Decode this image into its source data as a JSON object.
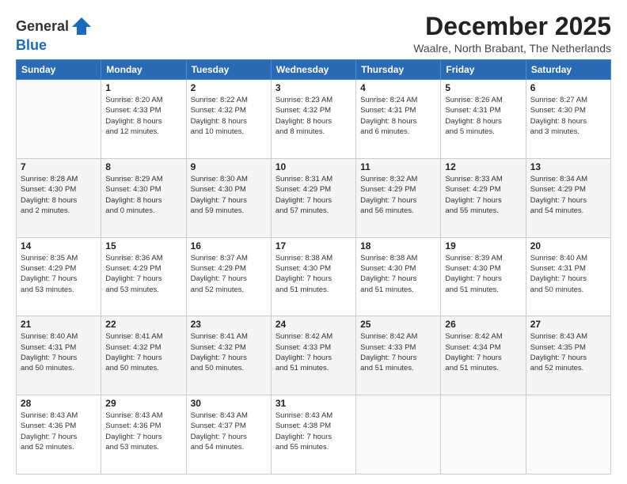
{
  "logo": {
    "line1": "General",
    "line2": "Blue"
  },
  "header": {
    "month_title": "December 2025",
    "subtitle": "Waalre, North Brabant, The Netherlands"
  },
  "days_of_week": [
    "Sunday",
    "Monday",
    "Tuesday",
    "Wednesday",
    "Thursday",
    "Friday",
    "Saturday"
  ],
  "weeks": [
    [
      {
        "day": "",
        "detail": ""
      },
      {
        "day": "1",
        "detail": "Sunrise: 8:20 AM\nSunset: 4:33 PM\nDaylight: 8 hours\nand 12 minutes."
      },
      {
        "day": "2",
        "detail": "Sunrise: 8:22 AM\nSunset: 4:32 PM\nDaylight: 8 hours\nand 10 minutes."
      },
      {
        "day": "3",
        "detail": "Sunrise: 8:23 AM\nSunset: 4:32 PM\nDaylight: 8 hours\nand 8 minutes."
      },
      {
        "day": "4",
        "detail": "Sunrise: 8:24 AM\nSunset: 4:31 PM\nDaylight: 8 hours\nand 6 minutes."
      },
      {
        "day": "5",
        "detail": "Sunrise: 8:26 AM\nSunset: 4:31 PM\nDaylight: 8 hours\nand 5 minutes."
      },
      {
        "day": "6",
        "detail": "Sunrise: 8:27 AM\nSunset: 4:30 PM\nDaylight: 8 hours\nand 3 minutes."
      }
    ],
    [
      {
        "day": "7",
        "detail": "Sunrise: 8:28 AM\nSunset: 4:30 PM\nDaylight: 8 hours\nand 2 minutes."
      },
      {
        "day": "8",
        "detail": "Sunrise: 8:29 AM\nSunset: 4:30 PM\nDaylight: 8 hours\nand 0 minutes."
      },
      {
        "day": "9",
        "detail": "Sunrise: 8:30 AM\nSunset: 4:30 PM\nDaylight: 7 hours\nand 59 minutes."
      },
      {
        "day": "10",
        "detail": "Sunrise: 8:31 AM\nSunset: 4:29 PM\nDaylight: 7 hours\nand 57 minutes."
      },
      {
        "day": "11",
        "detail": "Sunrise: 8:32 AM\nSunset: 4:29 PM\nDaylight: 7 hours\nand 56 minutes."
      },
      {
        "day": "12",
        "detail": "Sunrise: 8:33 AM\nSunset: 4:29 PM\nDaylight: 7 hours\nand 55 minutes."
      },
      {
        "day": "13",
        "detail": "Sunrise: 8:34 AM\nSunset: 4:29 PM\nDaylight: 7 hours\nand 54 minutes."
      }
    ],
    [
      {
        "day": "14",
        "detail": "Sunrise: 8:35 AM\nSunset: 4:29 PM\nDaylight: 7 hours\nand 53 minutes."
      },
      {
        "day": "15",
        "detail": "Sunrise: 8:36 AM\nSunset: 4:29 PM\nDaylight: 7 hours\nand 53 minutes."
      },
      {
        "day": "16",
        "detail": "Sunrise: 8:37 AM\nSunset: 4:29 PM\nDaylight: 7 hours\nand 52 minutes."
      },
      {
        "day": "17",
        "detail": "Sunrise: 8:38 AM\nSunset: 4:30 PM\nDaylight: 7 hours\nand 51 minutes."
      },
      {
        "day": "18",
        "detail": "Sunrise: 8:38 AM\nSunset: 4:30 PM\nDaylight: 7 hours\nand 51 minutes."
      },
      {
        "day": "19",
        "detail": "Sunrise: 8:39 AM\nSunset: 4:30 PM\nDaylight: 7 hours\nand 51 minutes."
      },
      {
        "day": "20",
        "detail": "Sunrise: 8:40 AM\nSunset: 4:31 PM\nDaylight: 7 hours\nand 50 minutes."
      }
    ],
    [
      {
        "day": "21",
        "detail": "Sunrise: 8:40 AM\nSunset: 4:31 PM\nDaylight: 7 hours\nand 50 minutes."
      },
      {
        "day": "22",
        "detail": "Sunrise: 8:41 AM\nSunset: 4:32 PM\nDaylight: 7 hours\nand 50 minutes."
      },
      {
        "day": "23",
        "detail": "Sunrise: 8:41 AM\nSunset: 4:32 PM\nDaylight: 7 hours\nand 50 minutes."
      },
      {
        "day": "24",
        "detail": "Sunrise: 8:42 AM\nSunset: 4:33 PM\nDaylight: 7 hours\nand 51 minutes."
      },
      {
        "day": "25",
        "detail": "Sunrise: 8:42 AM\nSunset: 4:33 PM\nDaylight: 7 hours\nand 51 minutes."
      },
      {
        "day": "26",
        "detail": "Sunrise: 8:42 AM\nSunset: 4:34 PM\nDaylight: 7 hours\nand 51 minutes."
      },
      {
        "day": "27",
        "detail": "Sunrise: 8:43 AM\nSunset: 4:35 PM\nDaylight: 7 hours\nand 52 minutes."
      }
    ],
    [
      {
        "day": "28",
        "detail": "Sunrise: 8:43 AM\nSunset: 4:36 PM\nDaylight: 7 hours\nand 52 minutes."
      },
      {
        "day": "29",
        "detail": "Sunrise: 8:43 AM\nSunset: 4:36 PM\nDaylight: 7 hours\nand 53 minutes."
      },
      {
        "day": "30",
        "detail": "Sunrise: 8:43 AM\nSunset: 4:37 PM\nDaylight: 7 hours\nand 54 minutes."
      },
      {
        "day": "31",
        "detail": "Sunrise: 8:43 AM\nSunset: 4:38 PM\nDaylight: 7 hours\nand 55 minutes."
      },
      {
        "day": "",
        "detail": ""
      },
      {
        "day": "",
        "detail": ""
      },
      {
        "day": "",
        "detail": ""
      }
    ]
  ]
}
